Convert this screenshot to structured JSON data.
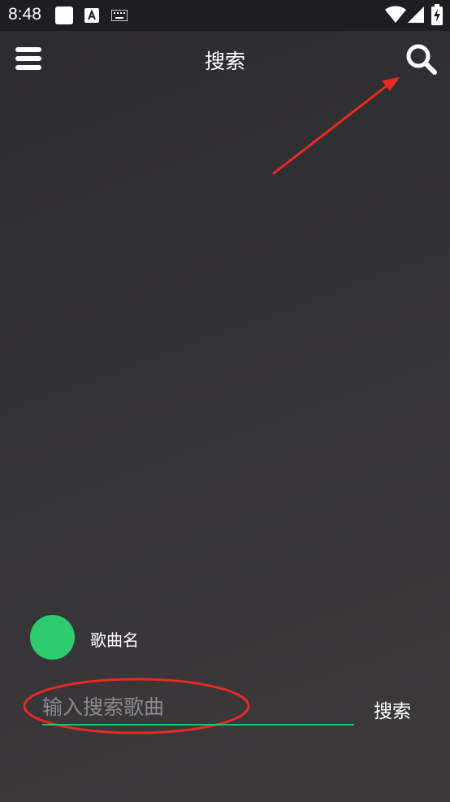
{
  "status_bar": {
    "time": "8:48",
    "keyboard_letter": "A"
  },
  "toolbar": {
    "title": "搜索",
    "menu_icon": "hamburger-menu-icon",
    "search_icon": "magnifier-icon"
  },
  "song": {
    "name": "歌曲名",
    "avatar_color": "#2ecc71"
  },
  "search": {
    "placeholder": "输入搜索歌曲",
    "value": "",
    "button_label": "搜索"
  },
  "colors": {
    "background": "#333235",
    "accent": "#2eb872",
    "annotation": "#e82a22"
  }
}
